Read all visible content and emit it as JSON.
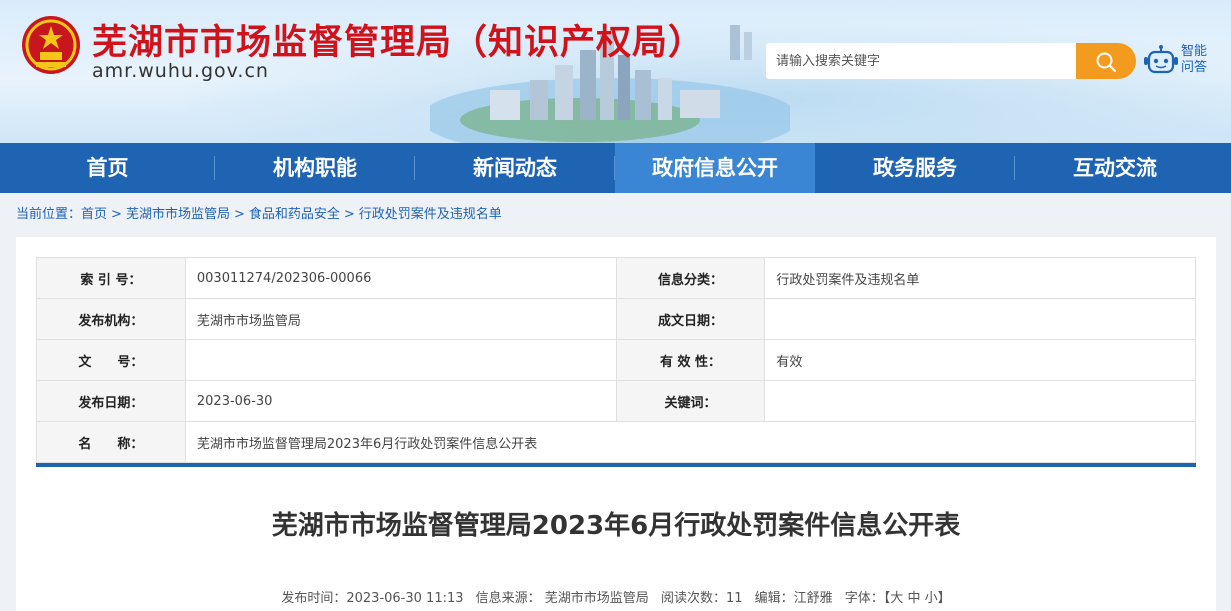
{
  "header": {
    "title": "芜湖市市场监督管理局（知识产权局）",
    "url": "amr.wuhu.gov.cn",
    "search_placeholder": "请输入搜索关键字",
    "assistant_label": "智能问答"
  },
  "nav": {
    "items": [
      {
        "label": "首页"
      },
      {
        "label": "机构职能"
      },
      {
        "label": "新闻动态"
      },
      {
        "label": "政府信息公开"
      },
      {
        "label": "政务服务"
      },
      {
        "label": "互动交流"
      }
    ],
    "active_index": 3
  },
  "breadcrumb": {
    "prefix": "当前位置：",
    "items": [
      "首页",
      "芜湖市市场监管局",
      "食品和药品安全",
      "行政处罚案件及违规名单"
    ],
    "separator": ">"
  },
  "meta": {
    "rows": [
      {
        "l1": "索 引 号：",
        "v1": "003011274/202306-00066",
        "l2": "信息分类：",
        "v2": "行政处罚案件及违规名单"
      },
      {
        "l1": "发布机构：",
        "v1": "芜湖市市场监管局",
        "l2": "成文日期：",
        "v2": ""
      },
      {
        "l1": "文　　号：",
        "v1": "",
        "l2": "有 效 性：",
        "v2": "有效"
      },
      {
        "l1": "发布日期：",
        "v1": "2023-06-30",
        "l2": "关键词：",
        "v2": ""
      }
    ],
    "name_label": "名　　称：",
    "name_value": "芜湖市市场监督管理局2023年6月行政处罚案件信息公开表"
  },
  "article": {
    "title": "芜湖市市场监督管理局2023年6月行政处罚案件信息公开表",
    "publish_time": "发布时间：2023-06-30 11:13",
    "source": "信息来源： 芜湖市市场监管局",
    "views": "阅读次数：11",
    "editor": "编辑：江舒雅",
    "font_size_label": "字体：",
    "font_sizes": [
      "【大",
      "中",
      "小】"
    ]
  },
  "colors": {
    "primary": "#1f63b3",
    "title_red": "#d0121b",
    "search_orange": "#f39b1f"
  }
}
